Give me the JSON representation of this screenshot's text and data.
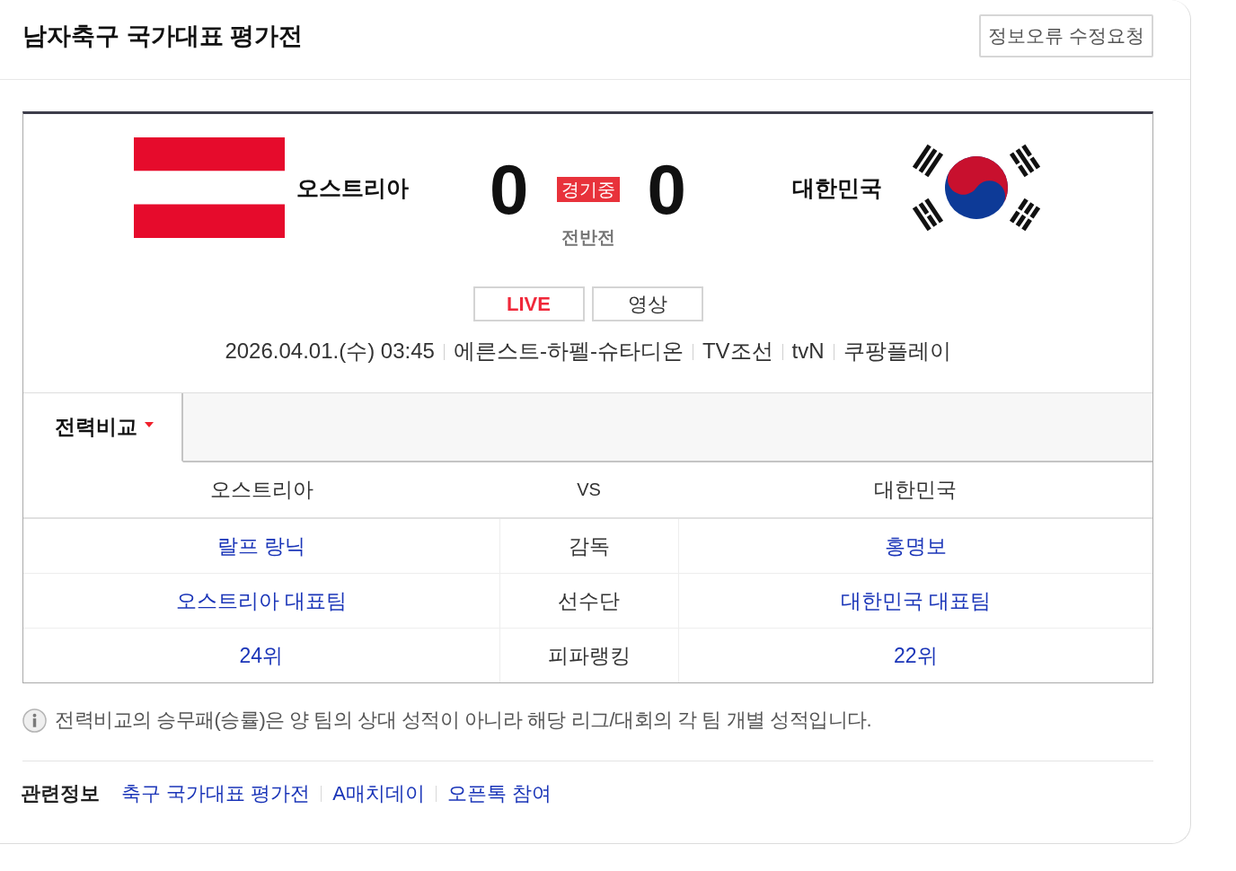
{
  "header": {
    "title": "남자축구 국가대표 평가전",
    "report_button": "정보오류 수정요청"
  },
  "match": {
    "home": {
      "name": "오스트리아",
      "score": "0"
    },
    "away": {
      "name": "대한민국",
      "score": "0"
    },
    "status_badge": "경기중",
    "period": "전반전",
    "buttons": [
      {
        "label": "LIVE",
        "kind": "live"
      },
      {
        "label": "영상",
        "kind": "video"
      }
    ],
    "details": [
      "2026.04.01.(수) 03:45",
      "에른스트-하펠-슈타디온",
      "TV조선",
      "tvN",
      "쿠팡플레이"
    ]
  },
  "tabs": [
    {
      "label": "전력비교",
      "selected": true
    }
  ],
  "comparison": {
    "columns": [
      "오스트리아",
      "VS",
      "대한민국"
    ],
    "rows": [
      {
        "home": "랄프 랑닉",
        "label": "감독",
        "away": "홍명보"
      },
      {
        "home": "오스트리아 대표팀",
        "label": "선수단",
        "away": "대한민국 대표팀"
      },
      {
        "home": "24위",
        "label": "피파랭킹",
        "away": "22위"
      }
    ]
  },
  "note": "전력비교의 승무패(승률)은 양 팀의 상대 성적이 아니라 해당 리그/대회의 각 팀 개별 성적입니다.",
  "related": {
    "label": "관련정보",
    "links": [
      "축구 국가대표 평가전",
      "A매치데이",
      "오픈톡 참여"
    ]
  }
}
